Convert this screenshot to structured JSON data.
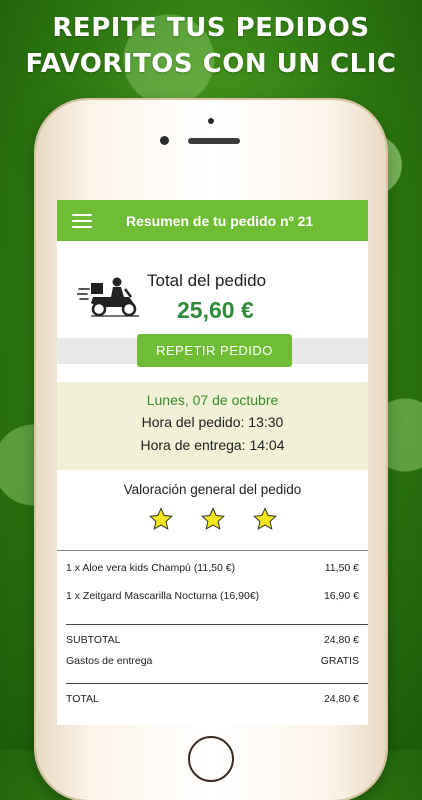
{
  "banner": {
    "line1": "REPITE TUS PEDIDOS",
    "line2": "FAVORITOS CON UN CLIC"
  },
  "header": {
    "title": "Resumen de tu pedido nº 21"
  },
  "order": {
    "total_label": "Total del pedido",
    "total_amount": "25,60 €",
    "repeat_button": "REPETIR PEDIDO",
    "date": "Lunes, 07 de octubre",
    "order_time": "Hora del pedido: 13:30",
    "delivery_time": "Hora de entrega: 14:04"
  },
  "rating": {
    "label": "Valoración general del pedido",
    "stars": 3,
    "star_color": "#f5e620"
  },
  "items": [
    {
      "description": "1 x Aloe vera kids Champú (11,50 €)",
      "price": "11,50 €"
    },
    {
      "description": "1 x Zeitgard Mascarilla Nocturna (16,90€)",
      "price": "16,90 €"
    }
  ],
  "summary": {
    "subtotal_label": "SUBTOTAL",
    "subtotal_value": "24,80 €",
    "shipping_label": "Gastos de entrega",
    "shipping_value": "GRATIS",
    "total_label": "TOTAL",
    "total_value": "24,80 €"
  },
  "colors": {
    "accent_green": "#6fbd34",
    "amount_green": "#2f8b38"
  }
}
